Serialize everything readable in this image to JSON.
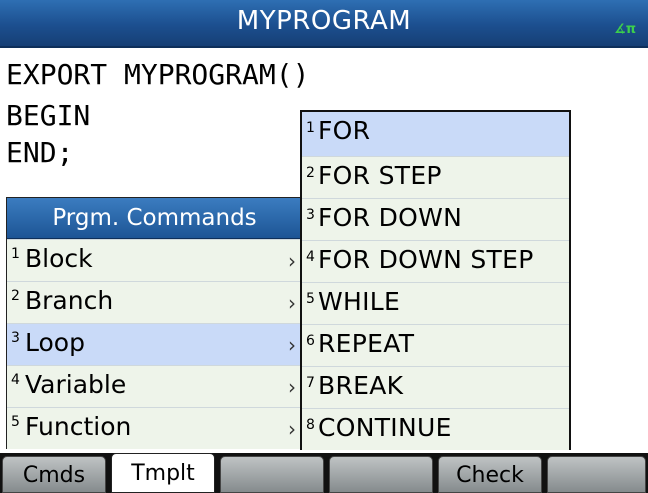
{
  "window": {
    "title": "MYPROGRAM",
    "angle_indicator": "∡π",
    "accent_color": "#1c4f8f",
    "selection_color": "#c9daf8"
  },
  "editor": {
    "lines": [
      "EXPORT MYPROGRAM()",
      "BEGIN",
      "END;"
    ]
  },
  "prgm_menu": {
    "title": "Prgm. Commands",
    "selected_index": 2,
    "items": [
      {
        "num": "1",
        "label": "Block"
      },
      {
        "num": "2",
        "label": "Branch"
      },
      {
        "num": "3",
        "label": "Loop"
      },
      {
        "num": "4",
        "label": "Variable"
      },
      {
        "num": "5",
        "label": "Function"
      }
    ],
    "submenu_arrow": "›"
  },
  "loop_menu": {
    "selected_index": 0,
    "items": [
      {
        "num": "1",
        "label": "FOR"
      },
      {
        "num": "2",
        "label": "FOR STEP"
      },
      {
        "num": "3",
        "label": "FOR DOWN"
      },
      {
        "num": "4",
        "label": "FOR DOWN STEP"
      },
      {
        "num": "5",
        "label": "WHILE"
      },
      {
        "num": "6",
        "label": "REPEAT"
      },
      {
        "num": "7",
        "label": "BREAK"
      },
      {
        "num": "8",
        "label": "CONTINUE"
      }
    ]
  },
  "softkeys": [
    "Cmds",
    "Tmplt",
    "",
    "",
    "Check",
    ""
  ]
}
